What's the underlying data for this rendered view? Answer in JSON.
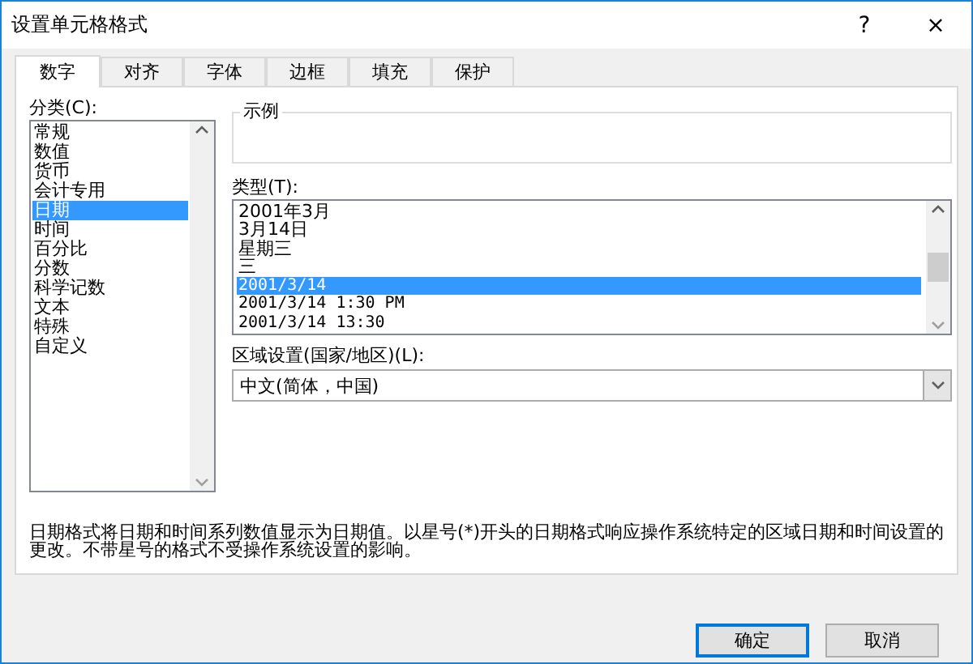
{
  "window": {
    "title": "设置单元格格式",
    "help": "?",
    "close": "×"
  },
  "tabs": [
    {
      "label": "数字",
      "selected": true
    },
    {
      "label": "对齐",
      "selected": false
    },
    {
      "label": "字体",
      "selected": false
    },
    {
      "label": "边框",
      "selected": false
    },
    {
      "label": "填充",
      "selected": false
    },
    {
      "label": "保护",
      "selected": false
    }
  ],
  "category": {
    "label": "分类(C):",
    "items": [
      {
        "label": "常规",
        "selected": false
      },
      {
        "label": "数值",
        "selected": false
      },
      {
        "label": "货币",
        "selected": false
      },
      {
        "label": "会计专用",
        "selected": false
      },
      {
        "label": "日期",
        "selected": true
      },
      {
        "label": "时间",
        "selected": false
      },
      {
        "label": "百分比",
        "selected": false
      },
      {
        "label": "分数",
        "selected": false
      },
      {
        "label": "科学记数",
        "selected": false
      },
      {
        "label": "文本",
        "selected": false
      },
      {
        "label": "特殊",
        "selected": false
      },
      {
        "label": "自定义",
        "selected": false
      }
    ]
  },
  "sample": {
    "label": "示例"
  },
  "type": {
    "label": "类型(T):",
    "items": [
      {
        "label": "2001年3月",
        "selected": false
      },
      {
        "label": "3月14日",
        "selected": false
      },
      {
        "label": "星期三",
        "selected": false
      },
      {
        "label": "三",
        "selected": false
      },
      {
        "label": "2001/3/14",
        "selected": true
      },
      {
        "label": "2001/3/14 1:30 PM",
        "selected": false
      },
      {
        "label": "2001/3/14 13:30",
        "selected": false
      }
    ]
  },
  "locale": {
    "label": "区域设置(国家/地区)(L):",
    "value": "中文(简体，中国)"
  },
  "description": "日期格式将日期和时间系列数值显示为日期值。以星号(*)开头的日期格式响应操作系统特定的区域日期和时间设置的更改。不带星号的格式不受操作系统设置的影响。",
  "buttons": [
    {
      "label": "确定",
      "kind": "default"
    },
    {
      "label": "取消",
      "kind": "normal"
    }
  ]
}
